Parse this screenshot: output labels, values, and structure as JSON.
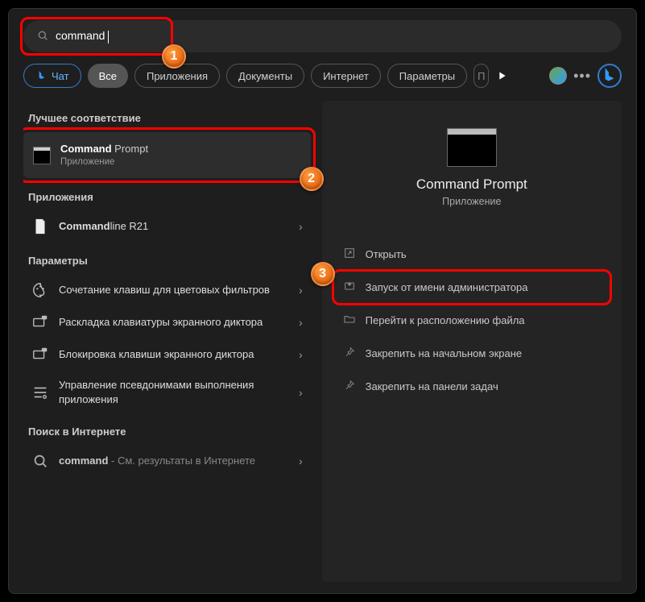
{
  "search": {
    "value": "command"
  },
  "tabs": {
    "chat": "Чат",
    "all": "Все",
    "apps": "Приложения",
    "docs": "Документы",
    "web": "Интернет",
    "settings": "Параметры",
    "stub": "П"
  },
  "left": {
    "best_match": "Лучшее соответствие",
    "cmd": {
      "title_bold": "Command",
      "title_rest": " Prompt",
      "sub": "Приложение"
    },
    "apps_title": "Приложения",
    "app1": {
      "bold": "Command",
      "rest": "line R21"
    },
    "settings_title": "Параметры",
    "s1": "Сочетание клавиш для цветовых фильтров",
    "s2": "Раскладка клавиатуры экранного диктора",
    "s3": "Блокировка клавиши экранного диктора",
    "s4": "Управление псевдонимами выполнения приложения",
    "web_title": "Поиск в Интернете",
    "web_bold": "command",
    "web_rest": " - См. результаты в Интернете"
  },
  "right": {
    "title": "Command Prompt",
    "sub": "Приложение",
    "a1": "Открыть",
    "a2": "Запуск от имени администратора",
    "a3": "Перейти к расположению файла",
    "a4": "Закрепить на начальном экране",
    "a5": "Закрепить на панели задач"
  },
  "badges": {
    "n1": "1",
    "n2": "2",
    "n3": "3"
  }
}
